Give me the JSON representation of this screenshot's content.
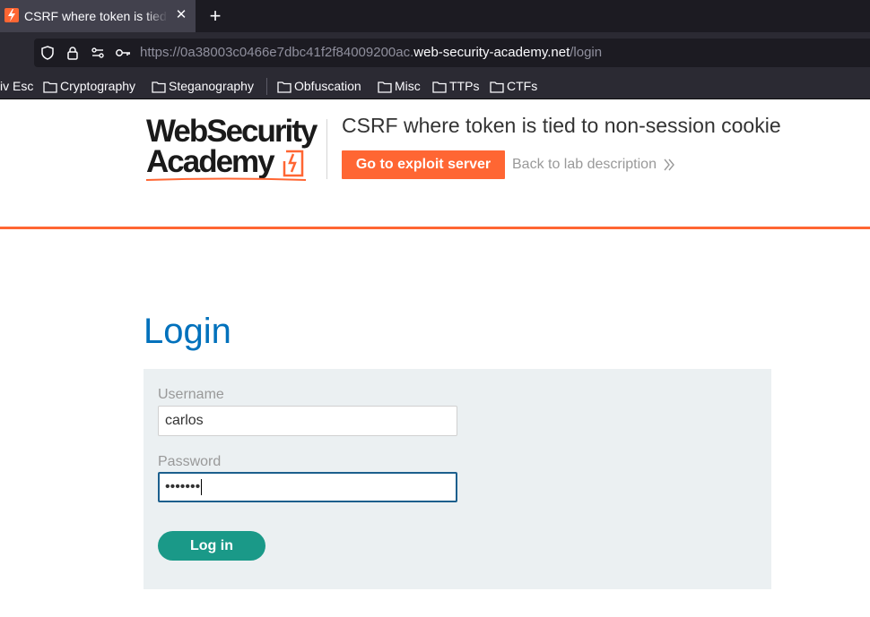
{
  "browser": {
    "tab_title": "CSRF where token is tied to non-session cookie",
    "tab_close": "✕",
    "new_tab": "+",
    "url_prefix": "https://0a38003c0466e7dbc41f2f84009200ac.",
    "url_domain": "web-security-academy.net",
    "url_path": "/login",
    "bookmarks": [
      "iv Esc",
      "Cryptography",
      "Steganography",
      "Obfuscation",
      "Misc",
      "TTPs",
      "CTFs"
    ],
    "icons": [
      "lightning-favicon-icon",
      "shield-icon",
      "lock-icon",
      "permissions-icon",
      "key-icon",
      "folder-icon"
    ]
  },
  "header": {
    "logo_line1": "WebSecurity",
    "logo_line2": "Academy",
    "lab_title": "CSRF where token is tied to non-session cookie",
    "exploit_button": "Go to exploit server",
    "back_link": "Back to lab description",
    "accent_color": "#ff6633"
  },
  "login": {
    "heading": "Login",
    "username_label": "Username",
    "username_value": "carlos",
    "password_label": "Password",
    "password_value": "•••••••",
    "submit_label": "Log in",
    "button_color": "#1a9988",
    "heading_color": "#0071bc"
  }
}
